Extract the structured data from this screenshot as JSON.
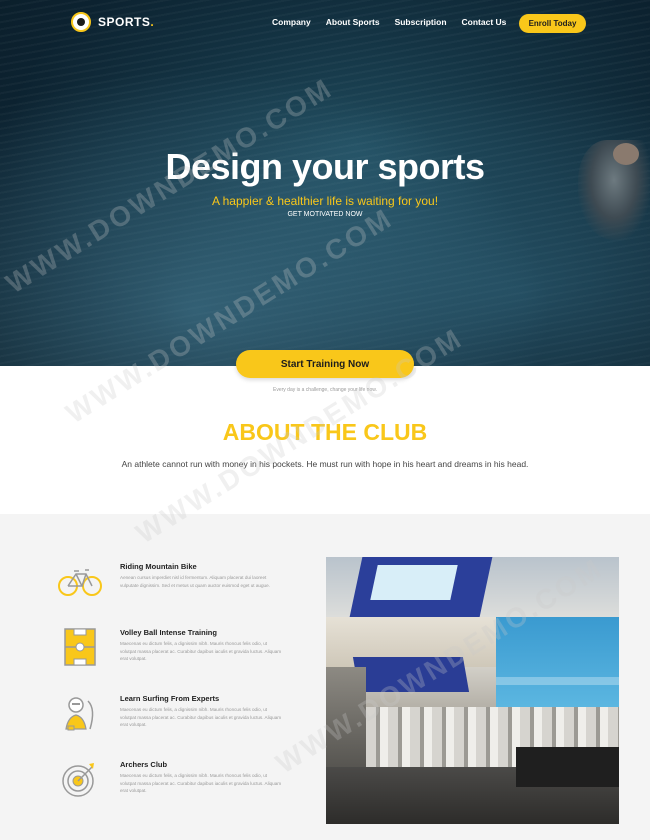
{
  "header": {
    "logo_text": "SPORTS",
    "logo_dot": ".",
    "nav": [
      "Company",
      "About Sports",
      "Subscription",
      "Contact Us"
    ],
    "enroll_label": "Enroll Today"
  },
  "hero": {
    "title": "Design your sports",
    "subtitle": "A happier & healthier life is waiting for you!",
    "small": "GET MOTIVATED NOW"
  },
  "cta": {
    "label": "Start Training Now",
    "caption": "Every day is a challenge, change your life now."
  },
  "about": {
    "title": "ABOUT THE CLUB",
    "text": "An athlete cannot run with money in his pockets. He must run with hope in his heart and dreams in his head."
  },
  "features": [
    {
      "title": "Riding Mountain Bike",
      "desc": "Aenean cursus imperdiet nisl id fermentum. Aliquam placerat dui laoreet vulputate dignissim. Sed et metus ut quam auctor euismod eget ut augue.",
      "icon": "bicycle-icon"
    },
    {
      "title": "Volley Ball Intense Training",
      "desc": "Maecenas eu dictum felis, a dignissim nibh. Mauris rhoncus felis odio, ut volutpat massa placerat ac. Curabitur dapibus iaculis et gravida luctus. Aliquam erat volutpat.",
      "icon": "volleyball-court-icon"
    },
    {
      "title": "Learn Surfing From Experts",
      "desc": "Maecenas eu dictum felis, a dignissim nibh. Mauris rhoncus felis odio, ut volutpat massa placerat ac. Curabitur dapibus iaculis et gravida luctus. Aliquam erat volutpat.",
      "icon": "surfer-icon"
    },
    {
      "title": "Archers Club",
      "desc": "Maecenas eu dictum felis, a dignissim nibh. Mauris rhoncus felis odio, ut volutpat massa placerat ac. Curabitur dapibus iaculis et gravida luctus. Aliquam erat volutpat.",
      "icon": "target-icon"
    }
  ],
  "watermark": "WWW.DOWNDEMO.COM",
  "colors": {
    "accent": "#f9c71a",
    "hero_bg": "#0c2230",
    "features_bg": "#f4f4f4"
  }
}
